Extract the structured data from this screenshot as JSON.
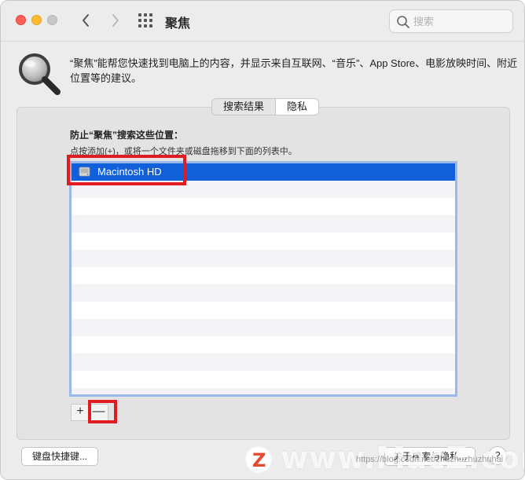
{
  "window": {
    "title": "聚焦"
  },
  "search": {
    "placeholder": "搜索"
  },
  "header": {
    "description": "“聚焦”能帮您快速找到电脑上的内容，并显示来自互联网、“音乐”、App Store、电影放映时间、附近位置等的建议。"
  },
  "tabs": [
    {
      "label": "搜索结果",
      "selected": false
    },
    {
      "label": "隐私",
      "selected": true
    }
  ],
  "privacy": {
    "heading": "防止“聚焦”搜索这些位置：",
    "hint": "点按添加(+)，或将一个文件夹或磁盘拖移到下面的列表中。",
    "items": [
      {
        "name": "Macintosh HD",
        "selected": true
      }
    ],
    "add_label": "+",
    "remove_label": "—"
  },
  "footer": {
    "shortcuts_label": "键盘快捷键...",
    "about_label": "关于搜索与隐私...",
    "help_label": "?"
  },
  "watermark": {
    "logo_letter": "Z",
    "brand": "www.MacZ.com",
    "url": "https://blog.csdn.net/zhuzhuzhuzhuhai"
  },
  "colors": {
    "selection": "#1160d9",
    "highlight_box": "#e01b22",
    "list_border": "#9ab8e8"
  }
}
